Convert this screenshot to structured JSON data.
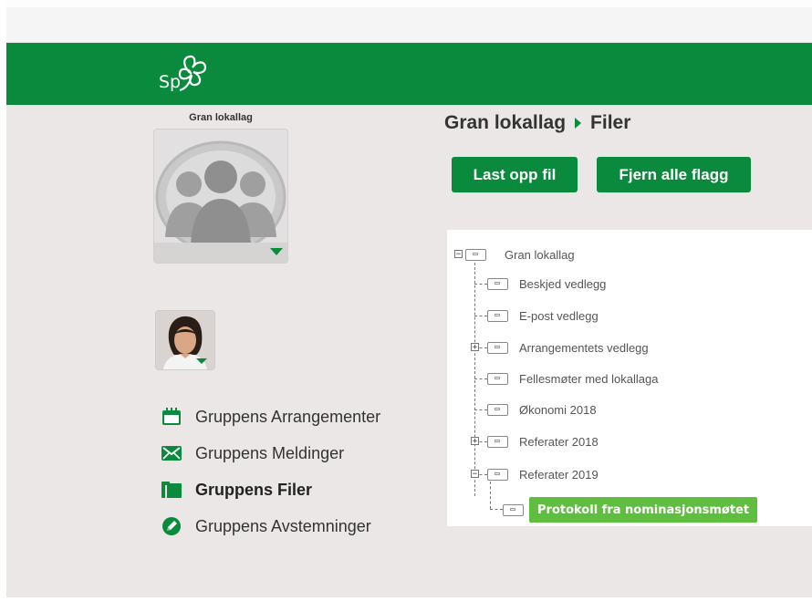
{
  "header": {
    "logo_text": "Sp"
  },
  "sidebar": {
    "group_name": "Gran lokallag",
    "menu": [
      {
        "label": "Gruppens Arrangementer",
        "icon": "calendar-icon"
      },
      {
        "label": "Gruppens Meldinger",
        "icon": "envelope-icon"
      },
      {
        "label": "Gruppens Filer",
        "icon": "folder-icon",
        "active": true
      },
      {
        "label": "Gruppens Avstemninger",
        "icon": "pencil-icon"
      }
    ]
  },
  "main": {
    "breadcrumb": {
      "root": "Gran lokallag",
      "current": "Filer"
    },
    "buttons": {
      "upload": "Last opp fil",
      "remove_flags": "Fjern alle flagg"
    },
    "tree": {
      "root": "Gran lokallag",
      "folders": [
        "Beskjed vedlegg",
        "E-post vedlegg",
        "Arrangementets vedlegg",
        "Fellesmøter med lokallaga",
        "Økonomi 2018",
        "Referater 2018",
        "Referater 2019"
      ],
      "drag_item": "Protokoll fra nominasjonsmøtet"
    }
  },
  "colors": {
    "brand_green": "#0a8a3c",
    "drag_green": "#5fbe3f",
    "background": "#ebe7e7"
  }
}
